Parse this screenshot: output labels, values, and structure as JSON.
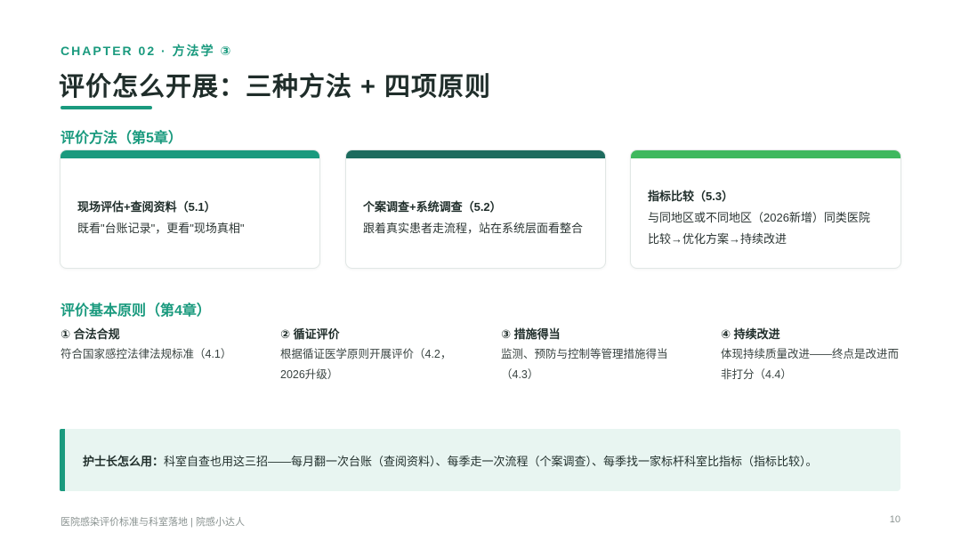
{
  "header": {
    "chapter": "CHAPTER 02 · 方法学 ③",
    "title": "评价怎么开展：三种方法 + 四项原则"
  },
  "methods_section": {
    "heading": "评价方法（第5章）",
    "cards": [
      {
        "title": "现场评估+查阅资料（5.1）",
        "desc": "既看\"台账记录\"，更看\"现场真相\"",
        "accent": "#1a9a7e"
      },
      {
        "title": "个案调查+系统调查（5.2）",
        "desc": "跟着真实患者走流程，站在系统层面看整合",
        "accent": "#1d6b5e"
      },
      {
        "title": "指标比较（5.3）",
        "desc_line1": "与同地区或不同地区（2026新增）同类医院",
        "desc_line2": "比较→优化方案→持续改进",
        "accent": "#3fb85e"
      }
    ]
  },
  "principles_section": {
    "heading": "评价基本原则（第4章）",
    "items": [
      {
        "title": "① 合法合规",
        "desc": "符合国家感控法律法规标准（4.1）"
      },
      {
        "title": "② 循证评价",
        "desc": "根据循证医学原则开展评价（4.2，2026升级）"
      },
      {
        "title": "③ 措施得当",
        "desc": "监测、预防与控制等管理措施得当（4.3）"
      },
      {
        "title": "④ 持续改进",
        "desc": "体现持续质量改进——终点是改进而非打分（4.4）"
      }
    ]
  },
  "callout": {
    "label": "护士长怎么用：",
    "text": "科室自查也用这三招——每月翻一次台账（查阅资料）、每季走一次流程（个案调查）、每季找一家标杆科室比指标（指标比较）。"
  },
  "footer": {
    "left": "医院感染评价标准与科室落地 | 院感小达人",
    "page_number": "10"
  }
}
